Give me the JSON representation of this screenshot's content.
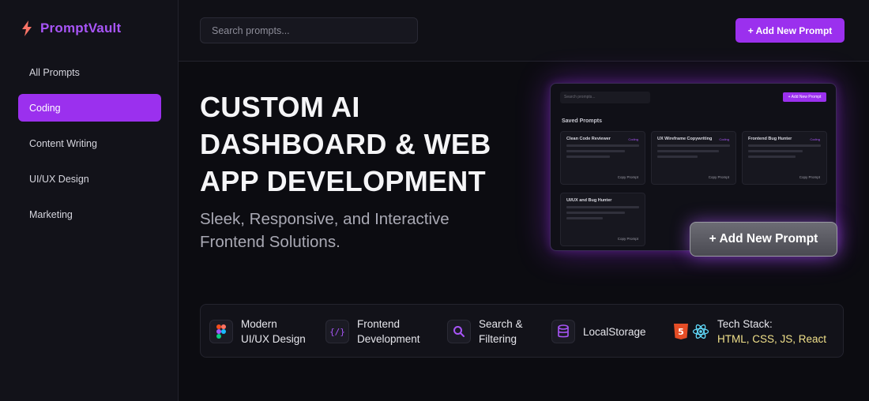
{
  "app": {
    "name": "PromptVault"
  },
  "sidebar": {
    "items": [
      {
        "label": "All Prompts",
        "active": false
      },
      {
        "label": "Coding",
        "active": true
      },
      {
        "label": "Content Writing",
        "active": false
      },
      {
        "label": "UI/UX Design",
        "active": false
      },
      {
        "label": "Marketing",
        "active": false
      }
    ]
  },
  "topbar": {
    "search_placeholder": "Search prompts...",
    "add_label": "+ Add New Prompt"
  },
  "hero": {
    "title_lines": [
      "CUSTOM AI",
      "DASHBOARD & WEB",
      "APP DEVELOPMENT"
    ],
    "subtitle_lines": [
      "Sleek, Responsive, and Interactive",
      "Frontend Solutions."
    ]
  },
  "preview": {
    "search_placeholder": "Search prompts...",
    "add_label": "+ Add New Prompt",
    "heading": "Saved Prompts",
    "cards": [
      {
        "title": "Clean Code Reviewer",
        "tag": "Coding",
        "foot": "Copy Prompt"
      },
      {
        "title": "UX Wireframe Copywriting",
        "tag": "Coding",
        "foot": "Copy Prompt"
      },
      {
        "title": "Frontend Bug Hunter",
        "tag": "Coding",
        "foot": "Copy Prompt"
      },
      {
        "title": "UI/UX and Bug Hunter",
        "tag": "",
        "foot": "Copy Prompt"
      }
    ],
    "big_button_label": "+ Add New Prompt"
  },
  "features": [
    {
      "icon": "figma-icon",
      "lines": [
        "Modern",
        "UI/UX Design"
      ]
    },
    {
      "icon": "code-braces-icon",
      "lines": [
        "Frontend",
        "Development"
      ]
    },
    {
      "icon": "search-icon",
      "lines": [
        "Search &",
        "Filtering"
      ]
    },
    {
      "icon": "database-icon",
      "lines": [
        "LocalStorage"
      ]
    },
    {
      "icon": "html5-react-icon",
      "lines": [
        "Tech Stack:",
        "HTML, CSS, JS, React"
      ]
    }
  ],
  "colors": {
    "accent": "#9b30ee",
    "brand": "#a855f7",
    "bg": "#0c0c11",
    "sidebar": "#121219",
    "highlight": "#f0e08a"
  }
}
